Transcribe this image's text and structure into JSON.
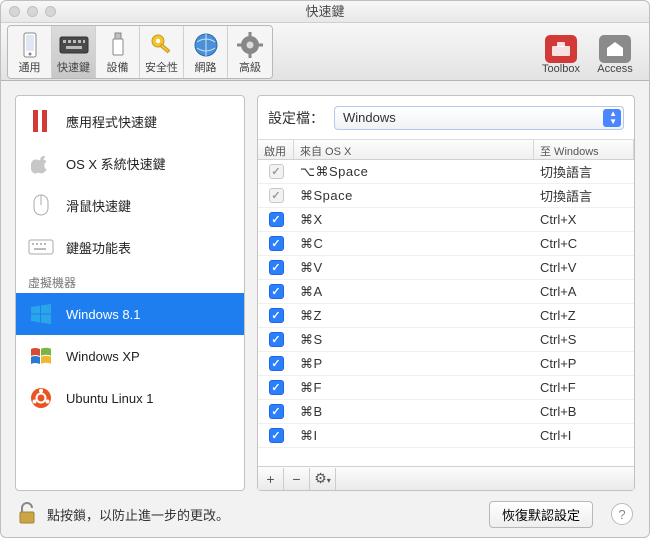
{
  "window": {
    "title": "快速鍵"
  },
  "toolbar": {
    "items": [
      {
        "label": "通用"
      },
      {
        "label": "快速鍵"
      },
      {
        "label": "設備"
      },
      {
        "label": "安全性"
      },
      {
        "label": "網路"
      },
      {
        "label": "高級"
      }
    ],
    "right": [
      {
        "label": "Toolbox"
      },
      {
        "label": "Access"
      }
    ]
  },
  "sidebar": {
    "items": [
      {
        "label": "應用程式快速鍵"
      },
      {
        "label": "OS X 系統快速鍵"
      },
      {
        "label": "滑鼠快速鍵"
      },
      {
        "label": "鍵盤功能表"
      }
    ],
    "vmheader": "虛擬機器",
    "vms": [
      {
        "label": "Windows 8.1"
      },
      {
        "label": "Windows XP"
      },
      {
        "label": "Ubuntu Linux 1"
      }
    ]
  },
  "profile": {
    "label": "設定檔：",
    "value": "Windows"
  },
  "table": {
    "headers": {
      "enable": "啟用",
      "from": "來自 OS X",
      "to": "至 Windows"
    },
    "rows": [
      {
        "enabled": true,
        "locked": true,
        "from": "⌥⌘Space",
        "to": "切換語言"
      },
      {
        "enabled": true,
        "locked": true,
        "from": "⌘Space",
        "to": "切換語言"
      },
      {
        "enabled": true,
        "locked": false,
        "from": "⌘X",
        "to": "Ctrl+X"
      },
      {
        "enabled": true,
        "locked": false,
        "from": "⌘C",
        "to": "Ctrl+C"
      },
      {
        "enabled": true,
        "locked": false,
        "from": "⌘V",
        "to": "Ctrl+V"
      },
      {
        "enabled": true,
        "locked": false,
        "from": "⌘A",
        "to": "Ctrl+A"
      },
      {
        "enabled": true,
        "locked": false,
        "from": "⌘Z",
        "to": "Ctrl+Z"
      },
      {
        "enabled": true,
        "locked": false,
        "from": "⌘S",
        "to": "Ctrl+S"
      },
      {
        "enabled": true,
        "locked": false,
        "from": "⌘P",
        "to": "Ctrl+P"
      },
      {
        "enabled": true,
        "locked": false,
        "from": "⌘F",
        "to": "Ctrl+F"
      },
      {
        "enabled": true,
        "locked": false,
        "from": "⌘B",
        "to": "Ctrl+B"
      },
      {
        "enabled": true,
        "locked": false,
        "from": "⌘I",
        "to": "Ctrl+I"
      }
    ]
  },
  "bottom": {
    "lockmsg": "點按鎖，以防止進一步的更改。",
    "restore": "恢復默認設定",
    "help": "?"
  },
  "icons": {
    "plus": "+",
    "minus": "−",
    "gear": "⚙"
  }
}
